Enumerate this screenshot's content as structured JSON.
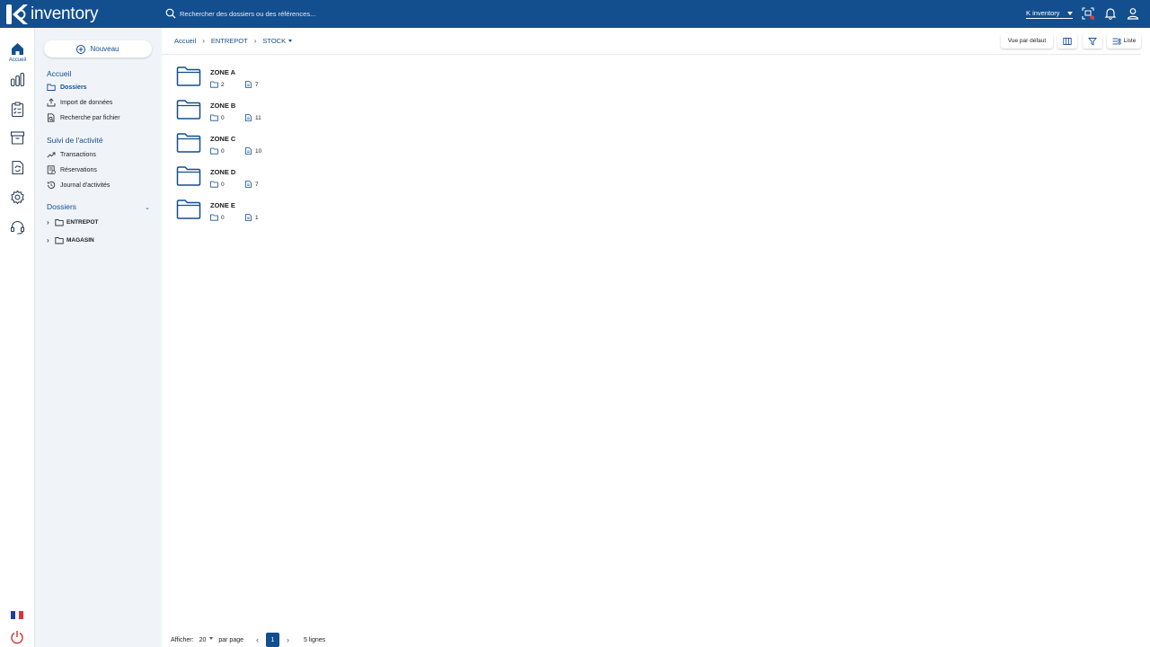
{
  "app": {
    "logo_text": "inventory",
    "search_placeholder": "Rechercher des dossiers ou des références...",
    "account": "K inventory"
  },
  "rail": {
    "home_label": "Accueil"
  },
  "sidebar": {
    "new_button": "Nouveau",
    "section_accueil": "Accueil",
    "items_accueil": [
      "Dossiers",
      "Import de données",
      "Recherche par fichier"
    ],
    "section_suivi": "Suivi de l'activité",
    "items_suivi": [
      "Transactions",
      "Réservations",
      "Journal d'activités"
    ],
    "section_dossiers": "Dossiers",
    "tree": [
      "ENTREPOT",
      "MAGASIN"
    ]
  },
  "breadcrumb": [
    "Accueil",
    "ENTREPOT",
    "STOCK"
  ],
  "toolbar": {
    "view_default": "Vue par défaut",
    "list_label": "Liste"
  },
  "folders": [
    {
      "name": "ZONE A",
      "subfolders": "2",
      "items": "7"
    },
    {
      "name": "ZONE B",
      "subfolders": "0",
      "items": "11"
    },
    {
      "name": "ZONE C",
      "subfolders": "0",
      "items": "10"
    },
    {
      "name": "ZONE D",
      "subfolders": "0",
      "items": "7"
    },
    {
      "name": "ZONE E",
      "subfolders": "0",
      "items": "1"
    }
  ],
  "pager": {
    "show_label": "Afficher:",
    "page_size": "20",
    "per_page": "par page",
    "current_page": "1",
    "rows_label": "5 lignes"
  },
  "colors": {
    "brand": "#134e8e",
    "sidebar_bg": "#f0f4f9",
    "notification": "#e53935",
    "power": "#d32f2f"
  },
  "icons": {
    "rail": [
      "home-icon",
      "chart-icon",
      "checklist-icon",
      "archive-icon",
      "sync-document-icon",
      "settings-icon",
      "support-headset-icon"
    ],
    "top": [
      "search-icon",
      "scan-icon",
      "bell-icon",
      "user-icon"
    ],
    "footer": [
      "france-flag-icon",
      "power-icon"
    ]
  }
}
